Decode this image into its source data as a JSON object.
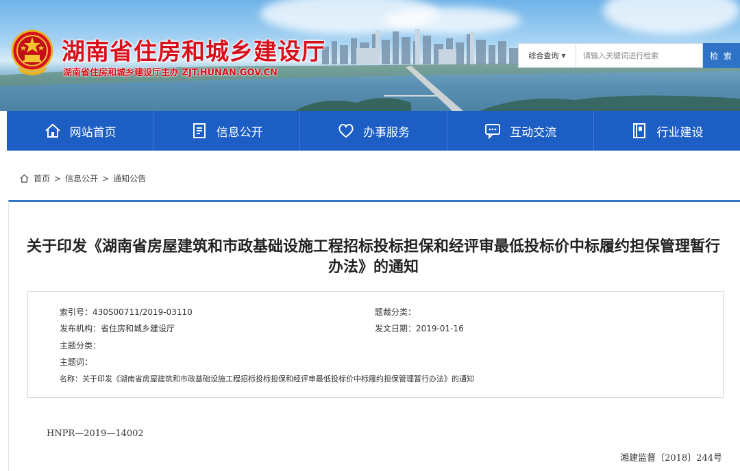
{
  "header": {
    "site_title": "湖南省住房和城乡建设厅",
    "site_subtitle": "湖南省住房和城乡建设厅主办  ZJT.HUNAN.GOV.CN",
    "search": {
      "scope_label": "综合查询",
      "placeholder": "请输入关键词进行检索",
      "button_label": "检 索"
    }
  },
  "nav": {
    "items": [
      {
        "label": "网站首页",
        "icon": "home-icon"
      },
      {
        "label": "信息公开",
        "icon": "document-icon"
      },
      {
        "label": "办事服务",
        "icon": "heart-icon"
      },
      {
        "label": "互动交流",
        "icon": "chat-icon"
      },
      {
        "label": "行业建设",
        "icon": "book-icon"
      }
    ]
  },
  "breadcrumb": {
    "items": [
      "首页",
      "信息公开",
      "通知公告"
    ],
    "separator": ">"
  },
  "article": {
    "title": "关于印发《湖南省房屋建筑和市政基础设施工程招标投标担保和经评审最低投标价中标履约担保管理暂行办法》的通知",
    "meta": {
      "index_label": "索引号：",
      "index_value": "430S00711/2019-03110",
      "topic_label": "题裁分类：",
      "topic_value": "",
      "issuer_label": "发布机构：",
      "issuer_value": "省住房和城乡建设厅",
      "date_label": "发文日期：",
      "date_value": "2019-01-16",
      "subject_label": "主题分类：",
      "subject_value": "",
      "keywords_label": "主题词：",
      "keywords_value": "",
      "name_label": "名称：",
      "name_value": "关于印发《湖南省房屋建筑和市政基础设施工程招标投标担保和经评审最低投标价中标履约担保管理暂行办法》的通知"
    },
    "doc_number": "HNPR—2019—14002",
    "doc_reference": "湘建监督〔2018〕244号"
  },
  "colors": {
    "brand_red": "#d8101b",
    "nav_blue": "#1c5ec3",
    "accent_blue": "#2f73c7"
  }
}
